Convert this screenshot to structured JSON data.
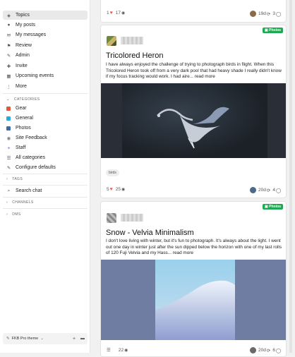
{
  "sidebar": {
    "nav": [
      {
        "label": "Topics",
        "icon": "layers-icon"
      },
      {
        "label": "My posts",
        "icon": "user-icon"
      },
      {
        "label": "My messages",
        "icon": "envelope-icon"
      },
      {
        "label": "Review",
        "icon": "flag-icon"
      },
      {
        "label": "Admin",
        "icon": "wrench-icon"
      },
      {
        "label": "Invite",
        "icon": "user-plus-icon"
      },
      {
        "label": "Upcoming events",
        "icon": "calendar-icon"
      },
      {
        "label": "More",
        "icon": "ellipsis-icon"
      }
    ],
    "categories_heading": "CATEGORIES",
    "categories": [
      {
        "label": "Gear",
        "color": "#e45735"
      },
      {
        "label": "General",
        "color": "#25aae2"
      },
      {
        "label": "Photos",
        "color": "#3d6aa8"
      },
      {
        "label": "Site Feedback",
        "color": "#808281"
      },
      {
        "label": "Staff",
        "color": "#b08fd8"
      },
      {
        "label": "All categories",
        "color": "#777777"
      },
      {
        "label": "Configure defaults",
        "color": "#777777"
      }
    ],
    "tags_heading": "TAGS",
    "search_chat": "Search chat",
    "channels_heading": "CHANNELS",
    "dms_heading": "DMS",
    "theme": "FKB Pro theme"
  },
  "top_card": {
    "likes": "1",
    "views": "17",
    "age": "19d",
    "replies": "3"
  },
  "posts": [
    {
      "category": "Photos",
      "title": "Tricolored Heron",
      "excerpt": "I have always enjoyed the challenge of trying to photograph birds in flight. When this Tricolored Heron took off from a very dark pool that had heavy shade I really didn't know if my focus tracking would work. I had aire... read more",
      "tag": "birds",
      "likes": "5",
      "views": "25",
      "age": "20d",
      "replies": "4"
    },
    {
      "category": "Photos",
      "title": "Snow - Velvia Minimalism",
      "excerpt": "I don't love living with winter, but it's fun to photograph. It's always about the light. I went out one day in winter just after the sun dipped below the horizon with one of my last rolls of 120 Fuji Velvia and my Hass... read more",
      "views": "22",
      "age": "20d",
      "replies": "6"
    }
  ],
  "colors": {
    "accent": "#1da851",
    "heart": "#e45959"
  }
}
